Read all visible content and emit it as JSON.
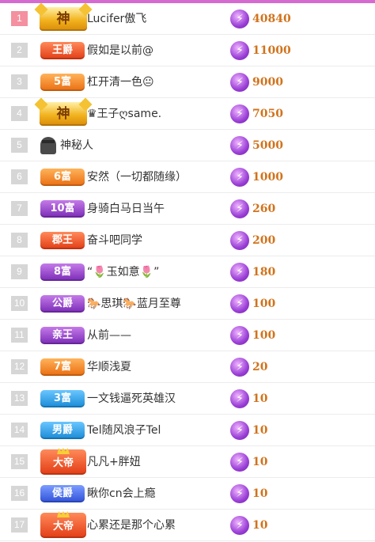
{
  "colors": {
    "top_bar": "#d56ad0",
    "rank_first": "#f4909f",
    "rank_default": "#d6d6d6",
    "points": "#d1731c",
    "coin": "#9a3fd6"
  },
  "rows": [
    {
      "rank": "1",
      "badge": "神",
      "badge_style": "gold",
      "name": "Lucifer傲飞",
      "points": "40840"
    },
    {
      "rank": "2",
      "badge": "王爵",
      "badge_style": "red",
      "name": "假如是以前@",
      "points": "11000"
    },
    {
      "rank": "3",
      "badge": "5富",
      "badge_style": "orange",
      "name": "杠开清一色😐",
      "points": "9000"
    },
    {
      "rank": "4",
      "badge": "神",
      "badge_style": "gold",
      "name": "♛王子ღsame.",
      "points": "7050"
    },
    {
      "rank": "5",
      "badge": "",
      "badge_style": "avatar",
      "name": "神秘人",
      "points": "5000"
    },
    {
      "rank": "6",
      "badge": "6富",
      "badge_style": "orange",
      "name": "安然（一切都随缘）",
      "points": "1000"
    },
    {
      "rank": "7",
      "badge": "10富",
      "badge_style": "purple",
      "name": "身骑白马日当午",
      "points": "260"
    },
    {
      "rank": "8",
      "badge": "郡王",
      "badge_style": "red",
      "name": "奋斗吧同学",
      "points": "200"
    },
    {
      "rank": "9",
      "badge": "8富",
      "badge_style": "purple",
      "name": "“🌷玉如意🌷”",
      "points": "180"
    },
    {
      "rank": "10",
      "badge": "公爵",
      "badge_style": "purple",
      "name": "🐎思琪🐎蓝月至尊",
      "points": "100"
    },
    {
      "rank": "11",
      "badge": "亲王",
      "badge_style": "purple",
      "name": "从前——",
      "points": "100"
    },
    {
      "rank": "12",
      "badge": "7富",
      "badge_style": "orange",
      "name": "华顺浅夏",
      "points": "20"
    },
    {
      "rank": "13",
      "badge": "3富",
      "badge_style": "blue",
      "name": "一文钱逼死英雄汉",
      "points": "10"
    },
    {
      "rank": "14",
      "badge": "男爵",
      "badge_style": "blue",
      "name": "Tel随风浪子Tel",
      "points": "10"
    },
    {
      "rank": "15",
      "badge": "大帝",
      "badge_style": "crown",
      "name": "凡凡+胖妞",
      "points": "10"
    },
    {
      "rank": "16",
      "badge": "侯爵",
      "badge_style": "bluep",
      "name": "瞅你cn会上瘾",
      "points": "10"
    },
    {
      "rank": "17",
      "badge": "大帝",
      "badge_style": "crown",
      "name": "心累还是那个心累",
      "points": "10"
    }
  ]
}
